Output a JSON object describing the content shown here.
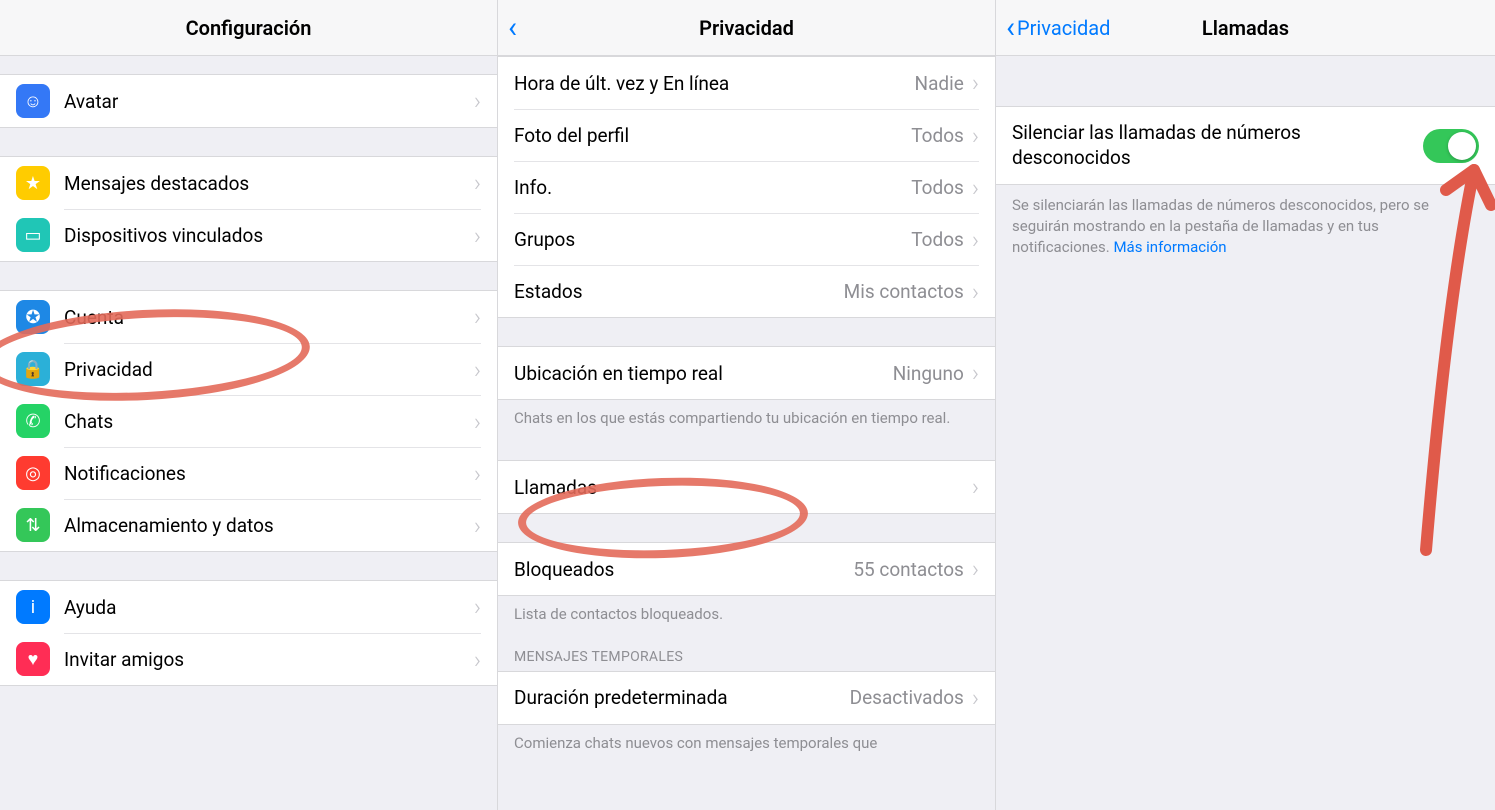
{
  "panel1": {
    "title": "Configuración",
    "groups": [
      {
        "rows": [
          {
            "key": "avatar",
            "icon": "avatar-icon",
            "bg": "bg-blue",
            "label": "Avatar",
            "glyph": "☺"
          }
        ]
      },
      {
        "rows": [
          {
            "key": "starred",
            "icon": "star-icon",
            "bg": "bg-yellow",
            "label": "Mensajes destacados",
            "glyph": "★"
          },
          {
            "key": "linked",
            "icon": "laptop-icon",
            "bg": "bg-teal",
            "label": "Dispositivos vinculados",
            "glyph": "▭"
          }
        ]
      },
      {
        "rows": [
          {
            "key": "account",
            "icon": "key-icon",
            "bg": "bg-blue2",
            "label": "Cuenta",
            "glyph": "✪"
          },
          {
            "key": "privacy",
            "icon": "lock-icon",
            "bg": "bg-cyan",
            "label": "Privacidad",
            "glyph": "🔒"
          },
          {
            "key": "chats",
            "icon": "whatsapp-icon",
            "bg": "bg-green",
            "label": "Chats",
            "glyph": "✆"
          },
          {
            "key": "notif",
            "icon": "bell-icon",
            "bg": "bg-red",
            "label": "Notificaciones",
            "glyph": "◎"
          },
          {
            "key": "storage",
            "icon": "arrows-icon",
            "bg": "bg-green2",
            "label": "Almacenamiento y datos",
            "glyph": "⇅"
          }
        ]
      },
      {
        "rows": [
          {
            "key": "help",
            "icon": "info-icon",
            "bg": "bg-blue3",
            "label": "Ayuda",
            "glyph": "i"
          },
          {
            "key": "invite",
            "icon": "heart-icon",
            "bg": "bg-pink",
            "label": "Invitar amigos",
            "glyph": "♥"
          }
        ]
      }
    ]
  },
  "panel2": {
    "title": "Privacidad",
    "sections": [
      {
        "rows": [
          {
            "key": "lastseen",
            "label": "Hora de últ. vez y En línea",
            "value": "Nadie"
          },
          {
            "key": "photo",
            "label": "Foto del perfil",
            "value": "Todos"
          },
          {
            "key": "info",
            "label": "Info.",
            "value": "Todos"
          },
          {
            "key": "groups",
            "label": "Grupos",
            "value": "Todos"
          },
          {
            "key": "status",
            "label": "Estados",
            "value": "Mis contactos"
          }
        ]
      },
      {
        "rows": [
          {
            "key": "location",
            "label": "Ubicación en tiempo real",
            "value": "Ninguno"
          }
        ],
        "footer": "Chats en los que estás compartiendo tu ubicación en tiempo real."
      },
      {
        "rows": [
          {
            "key": "calls",
            "label": "Llamadas",
            "value": ""
          }
        ]
      },
      {
        "rows": [
          {
            "key": "blocked",
            "label": "Bloqueados",
            "value": "55 contactos"
          }
        ],
        "footer": "Lista de contactos bloqueados."
      },
      {
        "header": "MENSAJES TEMPORALES",
        "rows": [
          {
            "key": "duration",
            "label": "Duración predeterminada",
            "value": "Desactivados"
          }
        ],
        "footer": "Comienza chats nuevos con mensajes temporales que"
      }
    ]
  },
  "panel3": {
    "back_label": "Privacidad",
    "title": "Llamadas",
    "toggle_label": "Silenciar las llamadas de números desconocidos",
    "footer_text": "Se silenciarán las llamadas de números desconocidos, pero se seguirán mostrando en la pestaña de llamadas y en tus notificaciones. ",
    "footer_link": "Más información"
  }
}
